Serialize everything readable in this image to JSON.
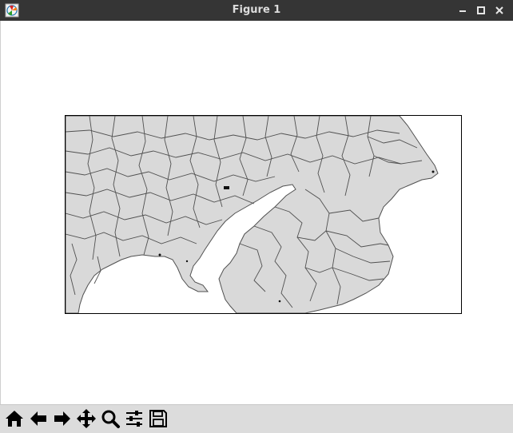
{
  "window": {
    "title": "Figure 1"
  },
  "icons": {
    "app": "matplotlib-icon",
    "minimize": "minimize-icon",
    "maximize": "maximize-icon",
    "close": "close-icon"
  },
  "toolbar": {
    "buttons": [
      {
        "name": "home-button",
        "icon": "home-icon"
      },
      {
        "name": "back-button",
        "icon": "arrow-left-icon"
      },
      {
        "name": "forward-button",
        "icon": "arrow-right-icon"
      },
      {
        "name": "pan-button",
        "icon": "move-icon"
      },
      {
        "name": "zoom-button",
        "icon": "magnifier-icon"
      },
      {
        "name": "configure-subplots-button",
        "icon": "sliders-icon"
      },
      {
        "name": "save-button",
        "icon": "floppy-disk-icon"
      }
    ]
  },
  "map": {
    "land_color": "#d9d9d9",
    "border_color": "#505050",
    "water_color": "#ffffff"
  }
}
